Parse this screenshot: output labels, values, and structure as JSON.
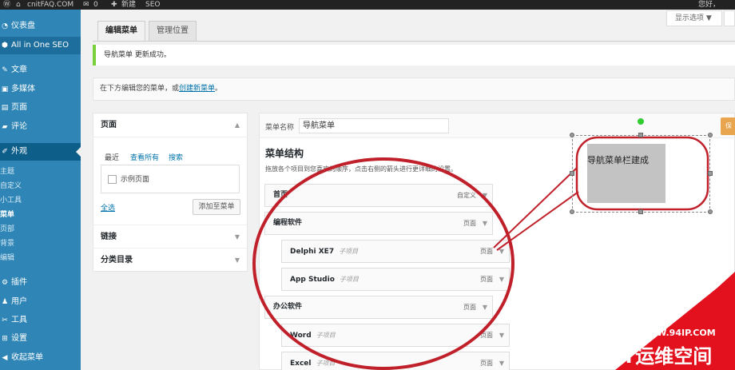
{
  "adminbar": {
    "site_name": "cnitFAQ.COM",
    "comments_count": "0",
    "new_label": "新建",
    "seo_label": "SEO",
    "greeting": "您好，"
  },
  "sidebar": {
    "items": [
      {
        "label": "仪表盘",
        "icon": "dashboard-icon"
      },
      {
        "label": "All in One SEO",
        "icon": "shield-icon"
      },
      {
        "label": "文章",
        "icon": "pin-icon"
      },
      {
        "label": "多媒体",
        "icon": "media-icon"
      },
      {
        "label": "页面",
        "icon": "page-icon"
      },
      {
        "label": "评论",
        "icon": "comment-icon"
      },
      {
        "label": "外观",
        "icon": "brush-icon"
      },
      {
        "label": "插件",
        "icon": "plugin-icon"
      },
      {
        "label": "用户",
        "icon": "user-icon"
      },
      {
        "label": "工具",
        "icon": "wrench-icon"
      },
      {
        "label": "设置",
        "icon": "settings-icon"
      },
      {
        "label": "收起菜单",
        "icon": "collapse-icon"
      }
    ],
    "subitems": [
      "主题",
      "自定义",
      "小工具",
      "菜单",
      "页部",
      "背景",
      "编辑"
    ]
  },
  "screen_options": "显示选项 ▼",
  "tabs": {
    "edit": "编辑菜单",
    "locations": "管理位置"
  },
  "notice": "导航菜单 更新成功。",
  "manage": {
    "prefix": "在下方编辑您的菜单，或",
    "link": "创建新菜单",
    "suffix": "。"
  },
  "accordion": {
    "pages_title": "页面",
    "tab_recent": "最近",
    "tab_all": "查看所有",
    "tab_search": "搜索",
    "sample_page": "示例页面",
    "select_all": "全选",
    "add_button": "添加至菜单",
    "links_title": "链接",
    "categories_title": "分类目录"
  },
  "menu": {
    "name_label": "菜单名称",
    "name_value": "导航菜单",
    "save_label": "保",
    "structure_title": "菜单结构",
    "structure_desc": "拖放各个项目到您喜欢的顺序，点击右侧的箭头进行更详细的设置。",
    "items": [
      {
        "title": "首页",
        "sub": "",
        "type": "自定义"
      },
      {
        "title": "编程软件",
        "sub": "",
        "type": "页面"
      },
      {
        "title": "Delphi XE7",
        "sub": "子项目",
        "type": "页面"
      },
      {
        "title": "App Studio",
        "sub": "子项目",
        "type": "页面"
      },
      {
        "title": "办公软件",
        "sub": "",
        "type": "页面"
      },
      {
        "title": "Word",
        "sub": "子项目",
        "type": "页面"
      },
      {
        "title": "Excel",
        "sub": "子项目",
        "type": "页面"
      }
    ]
  },
  "annotation": {
    "callout_text": "导航菜单栏建成",
    "circle_color": "#c0202a"
  },
  "watermark": {
    "url": "WWW.94IP.COM",
    "title": "IT运维空间",
    "color": "#e3101e"
  }
}
